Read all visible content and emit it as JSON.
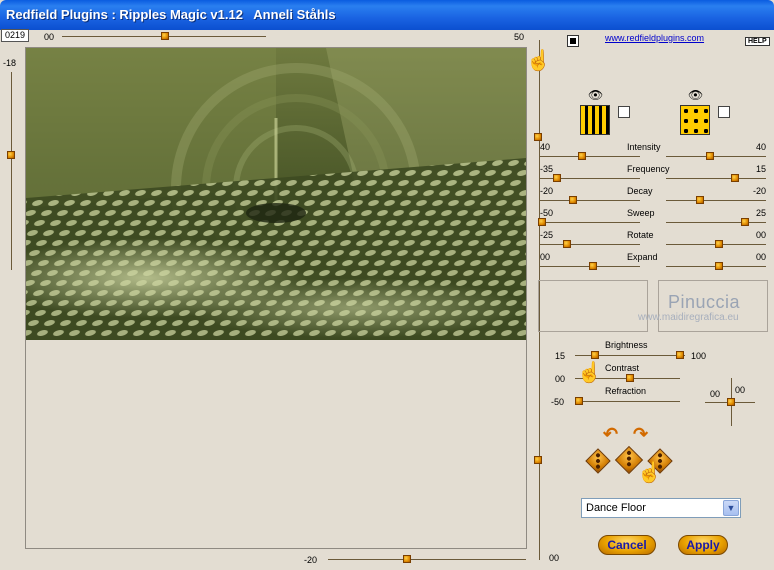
{
  "window": {
    "title": "Redfield Plugins : Ripples Magic v1.12   Anneli Ståhls"
  },
  "counter": "0219",
  "top_slider": {
    "value": "00",
    "right_value": "50"
  },
  "left_slider": {
    "value": "-18"
  },
  "bottom_slider": {
    "value": "-20"
  },
  "right_vertical_value": "00",
  "link": "www.redfieldplugins.com",
  "help": "HELP",
  "params": [
    {
      "name": "Intensity",
      "left": "40",
      "right": "40"
    },
    {
      "name": "Frequency",
      "left": "-35",
      "right": "15"
    },
    {
      "name": "Decay",
      "left": "-20",
      "right": "-20"
    },
    {
      "name": "Sweep",
      "left": "-50",
      "right": "25"
    },
    {
      "name": "Rotate",
      "left": "-25",
      "right": "00"
    },
    {
      "name": "Expand",
      "left": "00",
      "right": "00"
    }
  ],
  "watermark": {
    "line1": "Pinuccia",
    "line2": "www.maidiregrafica.eu"
  },
  "lighting": {
    "brightness": {
      "label": "Brightness",
      "min": "15",
      "max": "100"
    },
    "contrast": {
      "label": "Contrast",
      "value": "00"
    },
    "refraction": {
      "label": "Refraction",
      "value": "-50"
    }
  },
  "crosshair": {
    "x": "00",
    "y": "00"
  },
  "preset": {
    "selected": "Dance Floor"
  },
  "buttons": {
    "cancel": "Cancel",
    "apply": "Apply"
  },
  "icons": {
    "eye": "eye-icon",
    "hand": "pointing-hand-icon",
    "dice": "dice-icon",
    "arrow": "curved-arrow-icon"
  },
  "colors": {
    "title_bar": "#1a63e2",
    "background": "#e3ddd2",
    "accent": "#e08a00",
    "button_text": "#1a1aa8"
  }
}
